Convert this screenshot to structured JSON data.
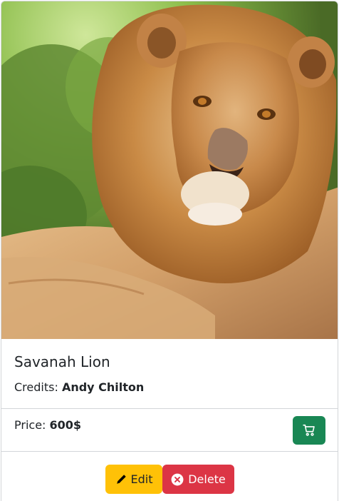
{
  "card": {
    "image_alt": "Savanah Lion",
    "title": "Savanah Lion",
    "credits_label": "Credits:",
    "credits_name": "Andy Chilton"
  },
  "pricing": {
    "price_label": "Price:",
    "price_value": "600$",
    "cart_icon": "cart-icon"
  },
  "actions": {
    "edit_label": "Edit",
    "edit_icon": "pencil-icon",
    "delete_label": "Delete",
    "delete_icon": "x-circle-icon"
  },
  "colors": {
    "success": "#198754",
    "warning": "#ffc107",
    "danger": "#dc3545",
    "border": "#d3d6d9"
  }
}
